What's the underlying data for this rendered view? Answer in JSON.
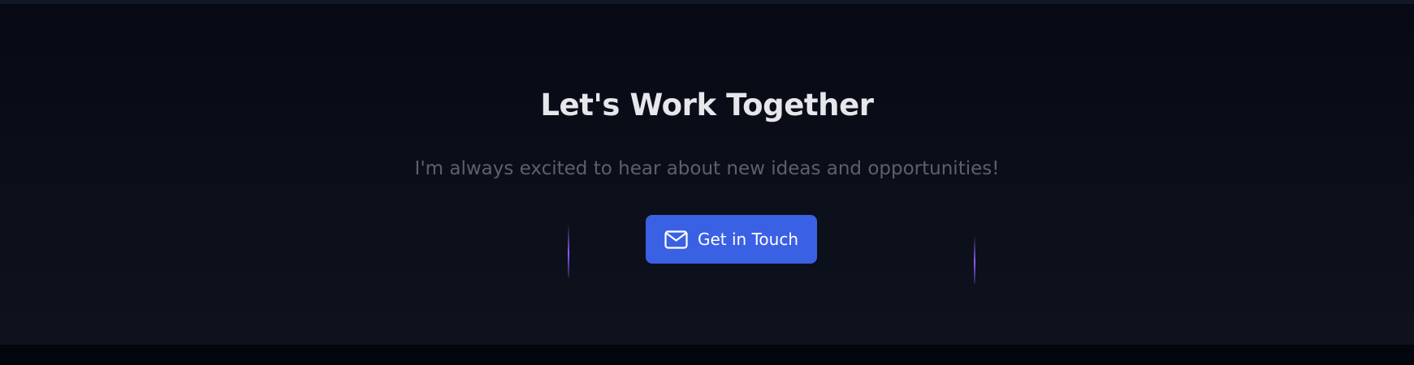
{
  "cta": {
    "title": "Let's Work Together",
    "subtitle": "I'm always excited to hear about new ideas and opportunities!",
    "button": {
      "label": "Get in Touch",
      "icon": "mail-icon"
    }
  },
  "colors": {
    "background": "#0b0f1a",
    "title": "#e5e7eb",
    "subtitle": "#5b606c",
    "button": "#3a60e4",
    "accent_beam": "#8b5cf6"
  }
}
